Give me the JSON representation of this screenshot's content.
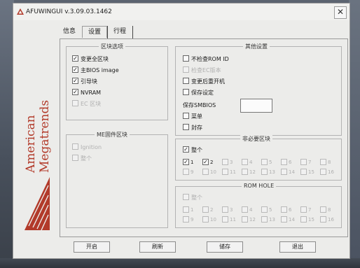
{
  "window": {
    "title": "AFUWINGUI v.3.09.03.1462",
    "close_glyph": "✕"
  },
  "tabs": [
    {
      "label": "信息"
    },
    {
      "label": "设置"
    },
    {
      "label": "行程"
    }
  ],
  "logo": {
    "line1": "American",
    "line2": "Megatrends"
  },
  "block_options": {
    "title": "区块选项",
    "items": [
      {
        "label": "变更全区块",
        "checked": true,
        "enabled": true
      },
      {
        "label": "主BIOS image",
        "checked": true,
        "enabled": true
      },
      {
        "label": "引导块",
        "checked": true,
        "enabled": true
      },
      {
        "label": "NVRAM",
        "checked": true,
        "enabled": true
      },
      {
        "label": "EC 区块",
        "checked": false,
        "enabled": false
      }
    ]
  },
  "other_settings": {
    "title": "其他设置",
    "items": [
      {
        "label": "不检查ROM ID",
        "checked": false,
        "enabled": true
      },
      {
        "label": "检查EC版本",
        "checked": false,
        "enabled": false
      },
      {
        "label": "变更后重开机",
        "checked": false,
        "enabled": true
      },
      {
        "label": "保存设定",
        "checked": false,
        "enabled": true
      }
    ],
    "smbios_label": "保存SMBIOS",
    "items2": [
      {
        "label": "菜单",
        "checked": false,
        "enabled": true
      },
      {
        "label": "封存",
        "checked": false,
        "enabled": true
      }
    ]
  },
  "me_firmware": {
    "title": "ME固件区块",
    "items": [
      {
        "label": "Ignition",
        "checked": false,
        "enabled": false
      },
      {
        "label": "整个",
        "checked": false,
        "enabled": false
      }
    ]
  },
  "non_critical": {
    "title": "非必要区块",
    "whole": {
      "label": "整个",
      "checked": true
    },
    "rows": [
      [
        {
          "n": "1",
          "checked": true,
          "enabled": true
        },
        {
          "n": "2",
          "checked": true,
          "enabled": true
        },
        {
          "n": "3",
          "checked": false,
          "enabled": false
        },
        {
          "n": "4",
          "checked": false,
          "enabled": false
        },
        {
          "n": "5",
          "checked": false,
          "enabled": false
        },
        {
          "n": "6",
          "checked": false,
          "enabled": false
        },
        {
          "n": "7",
          "checked": false,
          "enabled": false
        },
        {
          "n": "8",
          "checked": false,
          "enabled": false
        }
      ],
      [
        {
          "n": "9",
          "checked": false,
          "enabled": false
        },
        {
          "n": "10",
          "checked": false,
          "enabled": false
        },
        {
          "n": "11",
          "checked": false,
          "enabled": false
        },
        {
          "n": "12",
          "checked": false,
          "enabled": false
        },
        {
          "n": "13",
          "checked": false,
          "enabled": false
        },
        {
          "n": "14",
          "checked": false,
          "enabled": false
        },
        {
          "n": "15",
          "checked": false,
          "enabled": false
        },
        {
          "n": "16",
          "checked": false,
          "enabled": false
        }
      ]
    ]
  },
  "rom_hole": {
    "title": "ROM HOLE",
    "whole": {
      "label": "整个",
      "checked": false
    },
    "rows": [
      [
        {
          "n": "1",
          "checked": false,
          "enabled": false
        },
        {
          "n": "2",
          "checked": false,
          "enabled": false
        },
        {
          "n": "3",
          "checked": false,
          "enabled": false
        },
        {
          "n": "4",
          "checked": false,
          "enabled": false
        },
        {
          "n": "5",
          "checked": false,
          "enabled": false
        },
        {
          "n": "6",
          "checked": false,
          "enabled": false
        },
        {
          "n": "7",
          "checked": false,
          "enabled": false
        },
        {
          "n": "8",
          "checked": false,
          "enabled": false
        }
      ],
      [
        {
          "n": "9",
          "checked": false,
          "enabled": false
        },
        {
          "n": "10",
          "checked": false,
          "enabled": false
        },
        {
          "n": "11",
          "checked": false,
          "enabled": false
        },
        {
          "n": "12",
          "checked": false,
          "enabled": false
        },
        {
          "n": "13",
          "checked": false,
          "enabled": false
        },
        {
          "n": "14",
          "checked": false,
          "enabled": false
        },
        {
          "n": "15",
          "checked": false,
          "enabled": false
        },
        {
          "n": "16",
          "checked": false,
          "enabled": false
        }
      ]
    ]
  },
  "buttons": {
    "start": "开启",
    "refresh": "刷新",
    "save": "储存",
    "exit": "退出"
  },
  "colors": {
    "logo_red": "#b23a2a",
    "disabled_text": "#b0b0b0"
  }
}
